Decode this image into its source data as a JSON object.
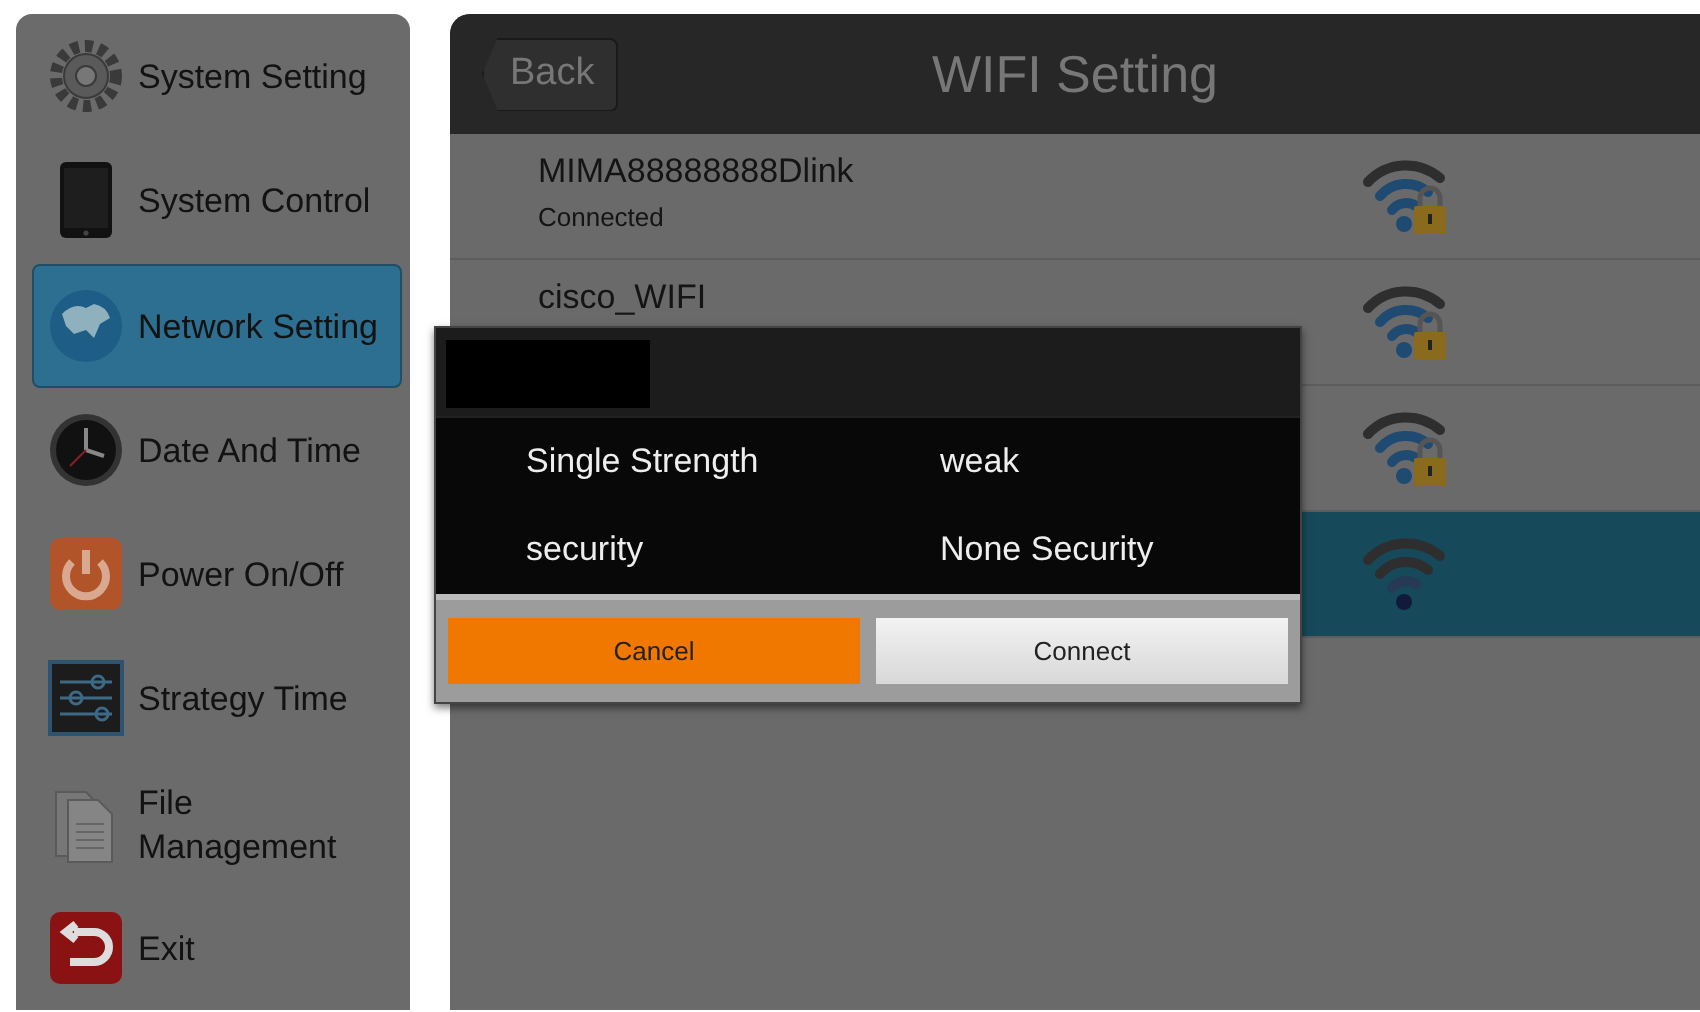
{
  "sidebar": {
    "items": [
      {
        "label": "System Setting",
        "selected": false
      },
      {
        "label": "System Control",
        "selected": false
      },
      {
        "label": "Network Setting",
        "selected": true
      },
      {
        "label": "Date And Time",
        "selected": false
      },
      {
        "label": "Power On/Off",
        "selected": false
      },
      {
        "label": "Strategy Time",
        "selected": false
      },
      {
        "label": "File Management",
        "selected": false
      },
      {
        "label": "Exit",
        "selected": false
      }
    ]
  },
  "header": {
    "back": "Back",
    "title": "WIFI Setting"
  },
  "networks": [
    {
      "name": "MIMA88888888Dlink",
      "status": "Connected",
      "secured": true,
      "selected": false
    },
    {
      "name": "cisco_WIFI",
      "secured": true,
      "selected": false
    },
    {
      "secured": true,
      "selected": false
    },
    {
      "secured": false,
      "selected": true
    }
  ],
  "dialog": {
    "rows": [
      {
        "label": "Single Strength",
        "value": "weak"
      },
      {
        "label": "security",
        "value": "None Security"
      }
    ],
    "buttons": [
      {
        "label": "Cancel",
        "kind": "cancel"
      },
      {
        "label": "Connect",
        "kind": "confirm"
      }
    ]
  }
}
